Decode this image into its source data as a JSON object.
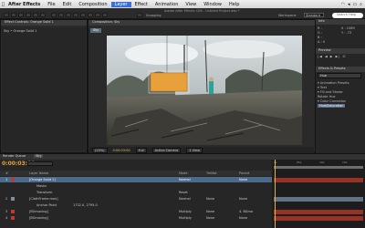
{
  "menubar": {
    "app_name": "After Effects",
    "items": [
      "File",
      "Edit",
      "Composition",
      "Layer",
      "Effect",
      "Animation",
      "View",
      "Window",
      "Help"
    ],
    "active_item": "Layer"
  },
  "toolbar": {
    "title": "Adobe After Effects CS6 - Untitled Project.aep *",
    "snapping": "Snapping",
    "workspace_label": "Workspace:",
    "workspace_value": "Standard",
    "search_placeholder": "Search Help"
  },
  "effect_controls": {
    "tab": "Effect Controls: Orange Solid 1",
    "layer": "Sky • Orange Solid 1"
  },
  "composition": {
    "tab": "Composition: Sky",
    "sub_tab": "Sky",
    "zoom": "(25%)",
    "timecode": "0:00:03:00",
    "resolution": "Full",
    "camera": "Active Camera",
    "views": "1 View"
  },
  "right_panel": {
    "info_header": "Info",
    "info_values": [
      "R :",
      "G :",
      "B :",
      "A : 0"
    ],
    "coords": [
      "X : 1089",
      "Y : -73"
    ],
    "preview_header": "Preview",
    "effects_header": "Effects & Presets",
    "effects_search": "Hue",
    "tree": [
      "▾ Animation Presets",
      "   ▾ Text",
      "      ▾ Fill and Stroke",
      "         Rotate Hue",
      "▾ Color Correction",
      "   Hue/Saturation"
    ],
    "tree_selected_index": 5
  },
  "timeline": {
    "tab": "Render Queue",
    "comp_tab": "Sky",
    "timecode": "0:00:03:00",
    "header": {
      "num": "#",
      "name": "Layer Name",
      "mode": "Mode",
      "trkmat": "TrkMat",
      "parent": "Parent"
    },
    "layers": [
      {
        "num": "1",
        "name": "[Orange Solid 1]",
        "mode": "Normal",
        "trkmat": "",
        "parent": "None",
        "color": "#c0392b",
        "selected": true
      },
      {
        "num": "",
        "name": "Masks",
        "mode": "",
        "trkmat": "",
        "parent": "",
        "color": "",
        "selected": false
      },
      {
        "num": "",
        "name": "Transform",
        "mode": "",
        "trkmat": "",
        "parent": "Reset",
        "color": "",
        "selected": false
      },
      {
        "num": "2",
        "name": "[ClothFrame.mov]",
        "mode": "Normal",
        "trkmat": "None",
        "parent": "None",
        "color": "#7a8ea8",
        "selected": false
      },
      {
        "num": "",
        "name": "Anchor Point",
        "mode": "1722.0, 2795.0",
        "trkmat": "",
        "parent": "",
        "color": "",
        "selected": false
      },
      {
        "num": "3",
        "name": "[BGmoving]",
        "mode": "Multiply",
        "trkmat": "None",
        "parent": "4. BGmo",
        "color": "#c0392b",
        "selected": false
      },
      {
        "num": "4",
        "name": "[BGmoving]",
        "mode": "Multiply",
        "trkmat": "None",
        "parent": "None",
        "color": "#c0392b",
        "selected": false
      }
    ],
    "ruler": [
      "0s",
      "05s",
      "10s",
      "15s"
    ]
  }
}
